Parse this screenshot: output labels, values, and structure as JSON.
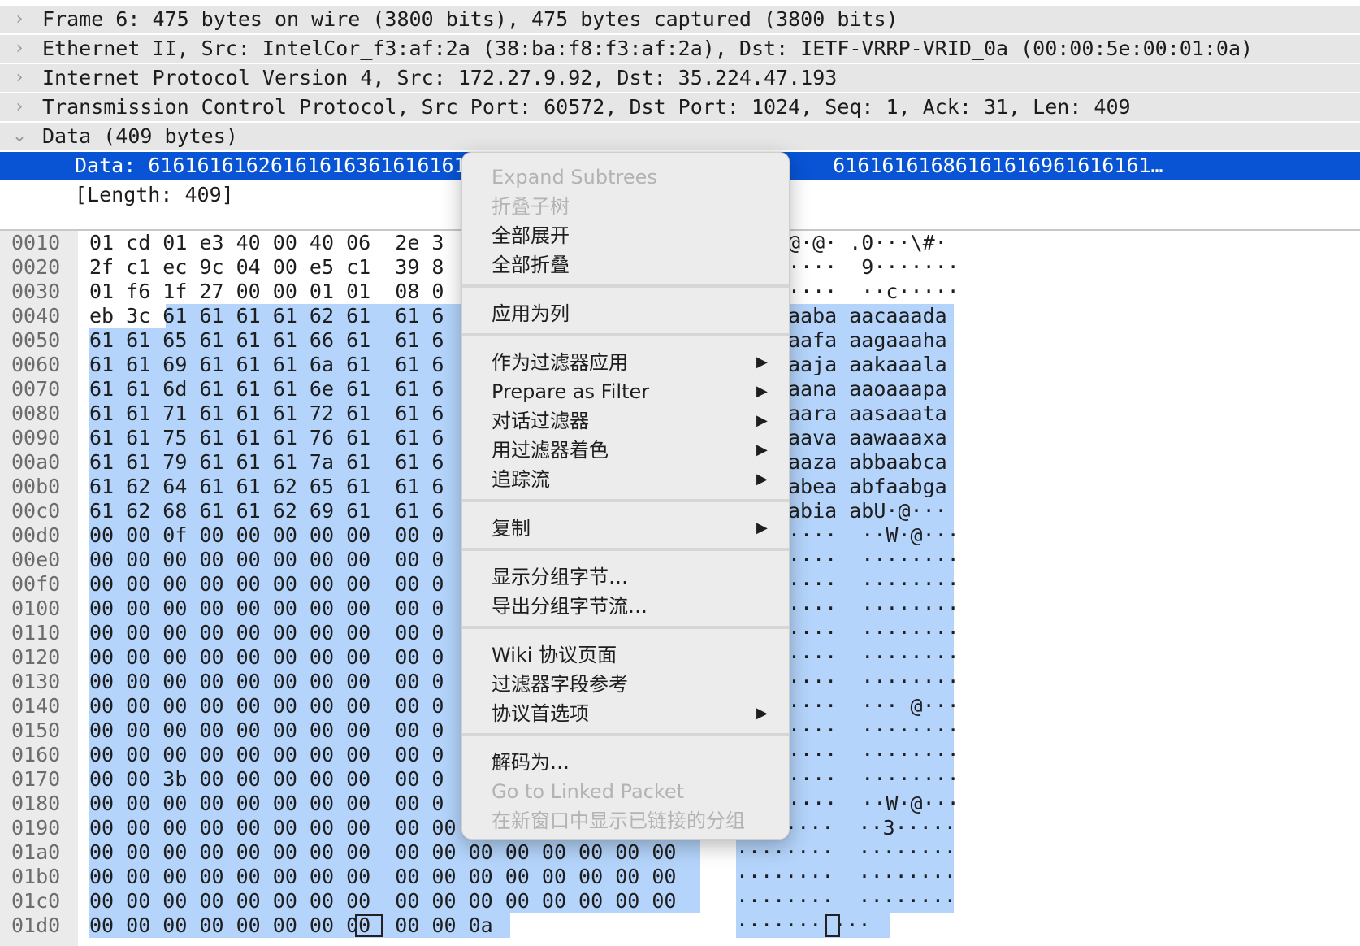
{
  "tree": {
    "disclosure_collapsed": "›",
    "disclosure_expanded": "⌄",
    "rows": [
      {
        "text": "Frame 6: 475 bytes on wire (3800 bits), 475 bytes captured (3800 bits)"
      },
      {
        "text": "Ethernet II, Src: IntelCor_f3:af:2a (38:ba:f8:f3:af:2a), Dst: IETF-VRRP-VRID_0a (00:00:5e:00:01:0a)"
      },
      {
        "text": "Internet Protocol Version 4, Src: 172.27.9.92, Dst: 35.224.47.193"
      },
      {
        "text": "Transmission Control Protocol, Src Port: 60572, Dst Port: 1024, Seq: 1, Ack: 31, Len: 409"
      },
      {
        "text": "Data (409 bytes)"
      },
      {
        "text": "Data: 61616161626161616361616161                              61616161686161616961616161…"
      },
      {
        "text": "[Length: 409]"
      }
    ]
  },
  "hex": {
    "rows": [
      {
        "offset": "0010",
        "hex": "01 cd 01 e3 40 00 40 06  2e 3",
        "ascii": "@·@· .0···\\#·"
      },
      {
        "offset": "0020",
        "hex": "2f c1 ec 9c 04 00 e5 c1  39 8",
        "ascii": "····  9·······"
      },
      {
        "offset": "0030",
        "hex": "01 f6 1f 27 00 00 01 01  08 0",
        "ascii": "····  ··c·····"
      },
      {
        "offset": "0040",
        "hex": "eb 3c 61 61 61 61 62 61  61 6",
        "ascii": "aaba aacaaada"
      },
      {
        "offset": "0050",
        "hex": "61 61 65 61 61 61 66 61  61 6",
        "ascii": "aafa aagaaaha"
      },
      {
        "offset": "0060",
        "hex": "61 61 69 61 61 61 6a 61  61 6",
        "ascii": "aaja aakaaala"
      },
      {
        "offset": "0070",
        "hex": "61 61 6d 61 61 61 6e 61  61 6",
        "ascii": "aana aaoaaapa"
      },
      {
        "offset": "0080",
        "hex": "61 61 71 61 61 61 72 61  61 6",
        "ascii": "aara aasaaata"
      },
      {
        "offset": "0090",
        "hex": "61 61 75 61 61 61 76 61  61 6",
        "ascii": "aava aawaaaxa"
      },
      {
        "offset": "00a0",
        "hex": "61 61 79 61 61 61 7a 61  61 6",
        "ascii": "aaza abbaabca"
      },
      {
        "offset": "00b0",
        "hex": "61 62 64 61 61 62 65 61  61 6",
        "ascii": "abea abfaabga"
      },
      {
        "offset": "00c0",
        "hex": "61 62 68 61 61 62 69 61  61 6",
        "ascii": "abia abU·@···"
      },
      {
        "offset": "00d0",
        "hex": "00 00 0f 00 00 00 00 00  00 0",
        "ascii": "····  ··W·@···"
      },
      {
        "offset": "00e0",
        "hex": "00 00 00 00 00 00 00 00  00 0",
        "ascii": "····  ········"
      },
      {
        "offset": "00f0",
        "hex": "00 00 00 00 00 00 00 00  00 0",
        "ascii": "····  ········"
      },
      {
        "offset": "0100",
        "hex": "00 00 00 00 00 00 00 00  00 0",
        "ascii": "····  ········"
      },
      {
        "offset": "0110",
        "hex": "00 00 00 00 00 00 00 00  00 0",
        "ascii": "····  ········"
      },
      {
        "offset": "0120",
        "hex": "00 00 00 00 00 00 00 00  00 0",
        "ascii": "····  ········"
      },
      {
        "offset": "0130",
        "hex": "00 00 00 00 00 00 00 00  00 0",
        "ascii": "····  ········"
      },
      {
        "offset": "0140",
        "hex": "00 00 00 00 00 00 00 00  00 0",
        "ascii": "····  ··· @···"
      },
      {
        "offset": "0150",
        "hex": "00 00 00 00 00 00 00 00  00 0",
        "ascii": "····  ········"
      },
      {
        "offset": "0160",
        "hex": "00 00 00 00 00 00 00 00  00 0",
        "ascii": "····  ········"
      },
      {
        "offset": "0170",
        "hex": "00 00 3b 00 00 00 00 00  00 0",
        "ascii": "····  ········"
      },
      {
        "offset": "0180",
        "hex": "00 00 00 00 00 00 00 00  00 0",
        "ascii": "····  ··W·@···"
      },
      {
        "offset": "0190",
        "hex": "00 00 00 00 00 00 00 00  00 00 33 00 00 00 00 00",
        "ascii": "········  ··3·····"
      },
      {
        "offset": "01a0",
        "hex": "00 00 00 00 00 00 00 00  00 00 00 00 00 00 00 00",
        "ascii": "········  ········"
      },
      {
        "offset": "01b0",
        "hex": "00 00 00 00 00 00 00 00  00 00 00 00 00 00 00 00",
        "ascii": "········  ········"
      },
      {
        "offset": "01c0",
        "hex": "00 00 00 00 00 00 00 00  00 00 00 00 00 00 00 00",
        "ascii": "········  ········"
      },
      {
        "offset": "01d0",
        "hex": "00 00 00 00 00 00 00 00  00 00 0a",
        "ascii": "······· ···"
      }
    ]
  },
  "context_menu": {
    "submenu_arrow": "▶",
    "items": [
      {
        "label": "Expand Subtrees",
        "disabled": true
      },
      {
        "label": "折叠子树",
        "disabled": true
      },
      {
        "label": "全部展开"
      },
      {
        "label": "全部折叠"
      },
      {
        "label": "应用为列"
      },
      {
        "label": "作为过滤器应用",
        "submenu": true
      },
      {
        "label": "Prepare as Filter",
        "submenu": true
      },
      {
        "label": "对话过滤器",
        "submenu": true
      },
      {
        "label": "用过滤器着色",
        "submenu": true
      },
      {
        "label": "追踪流",
        "submenu": true
      },
      {
        "label": "复制",
        "submenu": true
      },
      {
        "label": "显示分组字节…"
      },
      {
        "label": "导出分组字节流…"
      },
      {
        "label": "Wiki 协议页面"
      },
      {
        "label": "过滤器字段参考"
      },
      {
        "label": "协议首选项",
        "submenu": true
      },
      {
        "label": "解码为…"
      },
      {
        "label": "Go to Linked Packet",
        "disabled": true
      },
      {
        "label": "在新窗口中显示已链接的分组",
        "disabled": true
      }
    ]
  }
}
